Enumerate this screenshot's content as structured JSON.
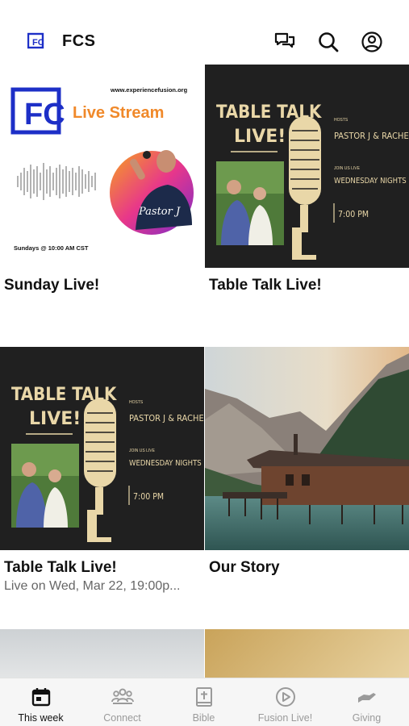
{
  "header": {
    "title": "FCS",
    "icons": [
      "fc-logo-icon",
      "chat-icon",
      "search-icon",
      "account-icon"
    ]
  },
  "cards": [
    {
      "title": "Sunday Live!",
      "thumb": {
        "website": "www.experiencefusion.org",
        "logo_letters": "FC",
        "brand": "Live Stream",
        "pastor_signature": "Pastor J",
        "schedule": "Sundays @ 10:00 AM CST",
        "colors": {
          "blue": "#1d2fc7",
          "orange": "#f0892a"
        }
      }
    },
    {
      "title": "Table Talk Live!",
      "thumb": {
        "headline_1": "TABLE TALK",
        "headline_2": "LIVE!",
        "hosts_label": "HOSTS",
        "hosts": "PASTOR J & RACHEL",
        "join_label": "JOIN US LIVE",
        "night": "WEDNESDAY NIGHTS",
        "time": "7:00 PM",
        "colors": {
          "cream": "#e9d7a8",
          "bg": "#1c1c1c"
        }
      }
    },
    {
      "title": "Table Talk Live!",
      "subtitle": "Live on Wed, Mar 22, 19:00p...",
      "thumb": {
        "headline_1": "TABLE TALK",
        "headline_2": "LIVE!",
        "hosts_label": "HOSTS",
        "hosts": "PASTOR J & RACHEL",
        "join_label": "JOIN US LIVE",
        "night": "WEDNESDAY NIGHTS",
        "time": "7:00 PM"
      }
    },
    {
      "title": "Our Story",
      "thumb": {
        "scene": "lake boathouse with mountains"
      }
    }
  ],
  "tabs": [
    {
      "label": "This week",
      "icon": "calendar-icon",
      "active": true
    },
    {
      "label": "Connect",
      "icon": "people-icon",
      "active": false
    },
    {
      "label": "Bible",
      "icon": "bible-icon",
      "active": false
    },
    {
      "label": "Fusion Live!",
      "icon": "play-circle-icon",
      "active": false
    },
    {
      "label": "Giving",
      "icon": "giving-hand-icon",
      "active": false
    }
  ]
}
